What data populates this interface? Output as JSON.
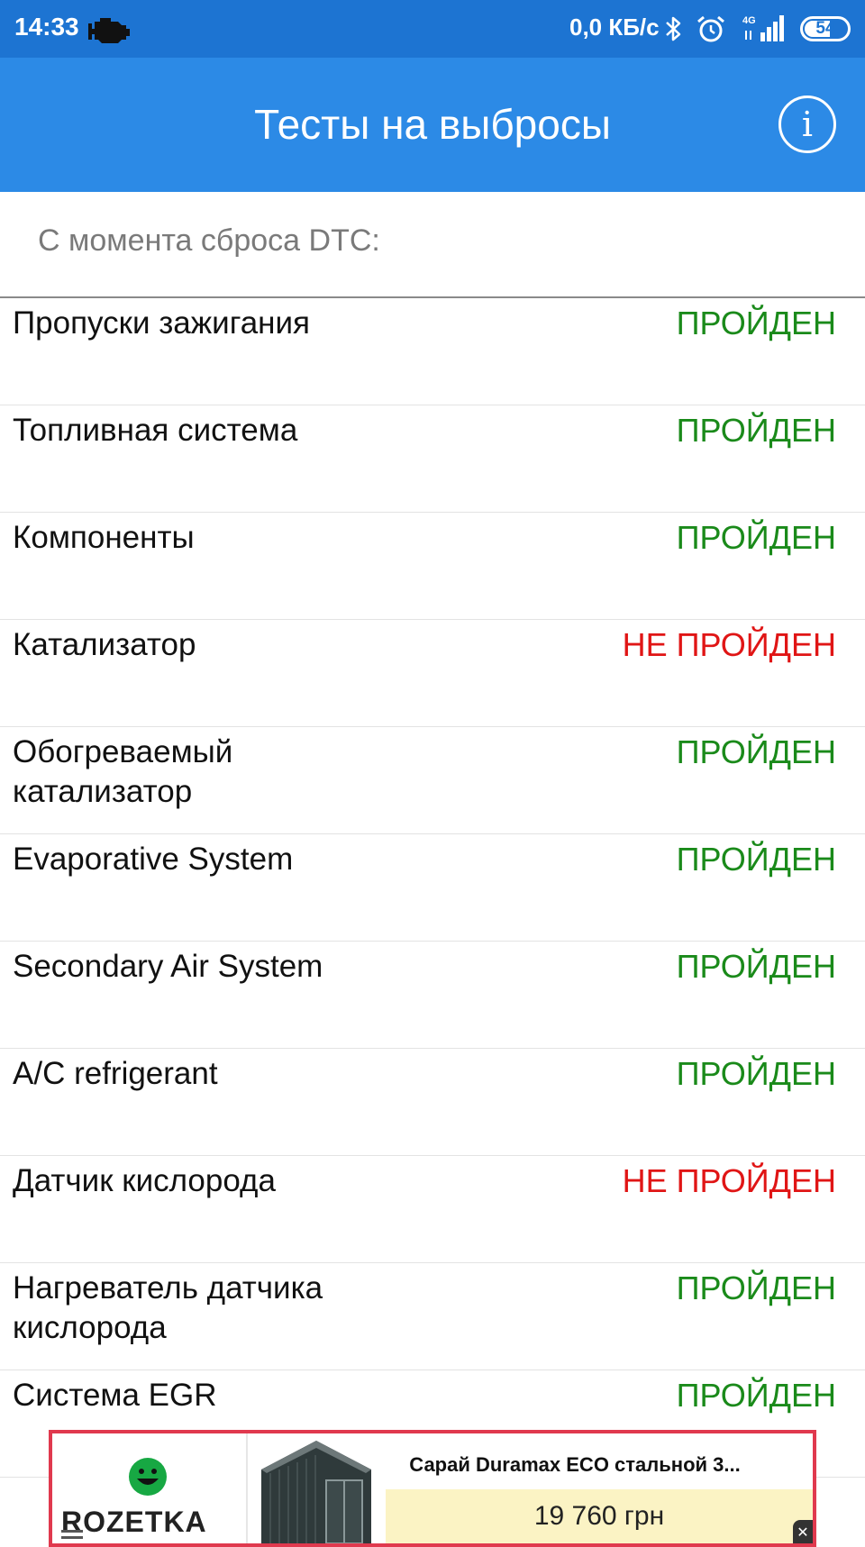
{
  "status_bar": {
    "time": "14:33",
    "network_speed": "0,0 КБ/с",
    "network_type": "4G",
    "battery": "54",
    "icons": [
      "engine-icon",
      "bluetooth-icon",
      "alarm-icon",
      "signal-icon",
      "battery-icon"
    ]
  },
  "app_bar": {
    "title": "Тесты на выбросы",
    "info_button": "i"
  },
  "section": {
    "header": "С момента сброса DTC:"
  },
  "colors": {
    "status_bar": "#1d74d2",
    "app_bar": "#2c8ae6",
    "passed": "#1a8a1a",
    "failed": "#e01515",
    "ad_border": "#e0394e"
  },
  "tests": [
    {
      "name": "Пропуски зажигания",
      "status": "ПРОЙДЕН",
      "passed": true
    },
    {
      "name": "Топливная система",
      "status": "ПРОЙДЕН",
      "passed": true
    },
    {
      "name": "Компоненты",
      "status": "ПРОЙДЕН",
      "passed": true
    },
    {
      "name": "Катализатор",
      "status": "НЕ ПРОЙДЕН",
      "passed": false
    },
    {
      "name": "Обогреваемый катализатор",
      "status": "ПРОЙДЕН",
      "passed": true
    },
    {
      "name": "Evaporative System",
      "status": "ПРОЙДЕН",
      "passed": true
    },
    {
      "name": "Secondary Air System",
      "status": "ПРОЙДЕН",
      "passed": true
    },
    {
      "name": "A/C refrigerant",
      "status": "ПРОЙДЕН",
      "passed": true
    },
    {
      "name": "Датчик кислорода",
      "status": "НЕ ПРОЙДЕН",
      "passed": false
    },
    {
      "name": "Нагреватель датчика кислорода",
      "status": "ПРОЙДЕН",
      "passed": true
    },
    {
      "name": "Система EGR",
      "status": "ПРОЙДЕН",
      "passed": true
    }
  ],
  "ad": {
    "brand": "ROZETKA",
    "product_title": "Сарай Duramax ECO стальной 3...",
    "price": "19 760 грн",
    "close_label": "✕"
  }
}
